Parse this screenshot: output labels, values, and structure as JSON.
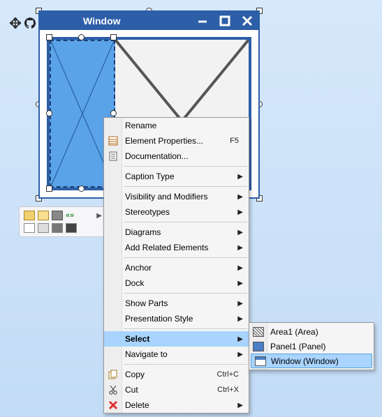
{
  "window": {
    "title": "Window"
  },
  "menu": {
    "rename": "Rename",
    "props": "Element Properties...",
    "props_key": "F5",
    "docs": "Documentation...",
    "caption": "Caption Type",
    "vis": "Visibility and Modifiers",
    "stereo": "Stereotypes",
    "diagrams": "Diagrams",
    "addrel": "Add Related Elements",
    "anchor": "Anchor",
    "dock": "Dock",
    "showparts": "Show Parts",
    "pstyle": "Presentation Style",
    "select": "Select",
    "navto": "Navigate to",
    "copy": "Copy",
    "copy_key": "Ctrl+C",
    "cut": "Cut",
    "cut_key": "Ctrl+X",
    "delete": "Delete"
  },
  "submenu": {
    "items": [
      {
        "label": "Area1 (Area)"
      },
      {
        "label": "Panel1 (Panel)"
      },
      {
        "label": "Window (Window)"
      }
    ]
  }
}
